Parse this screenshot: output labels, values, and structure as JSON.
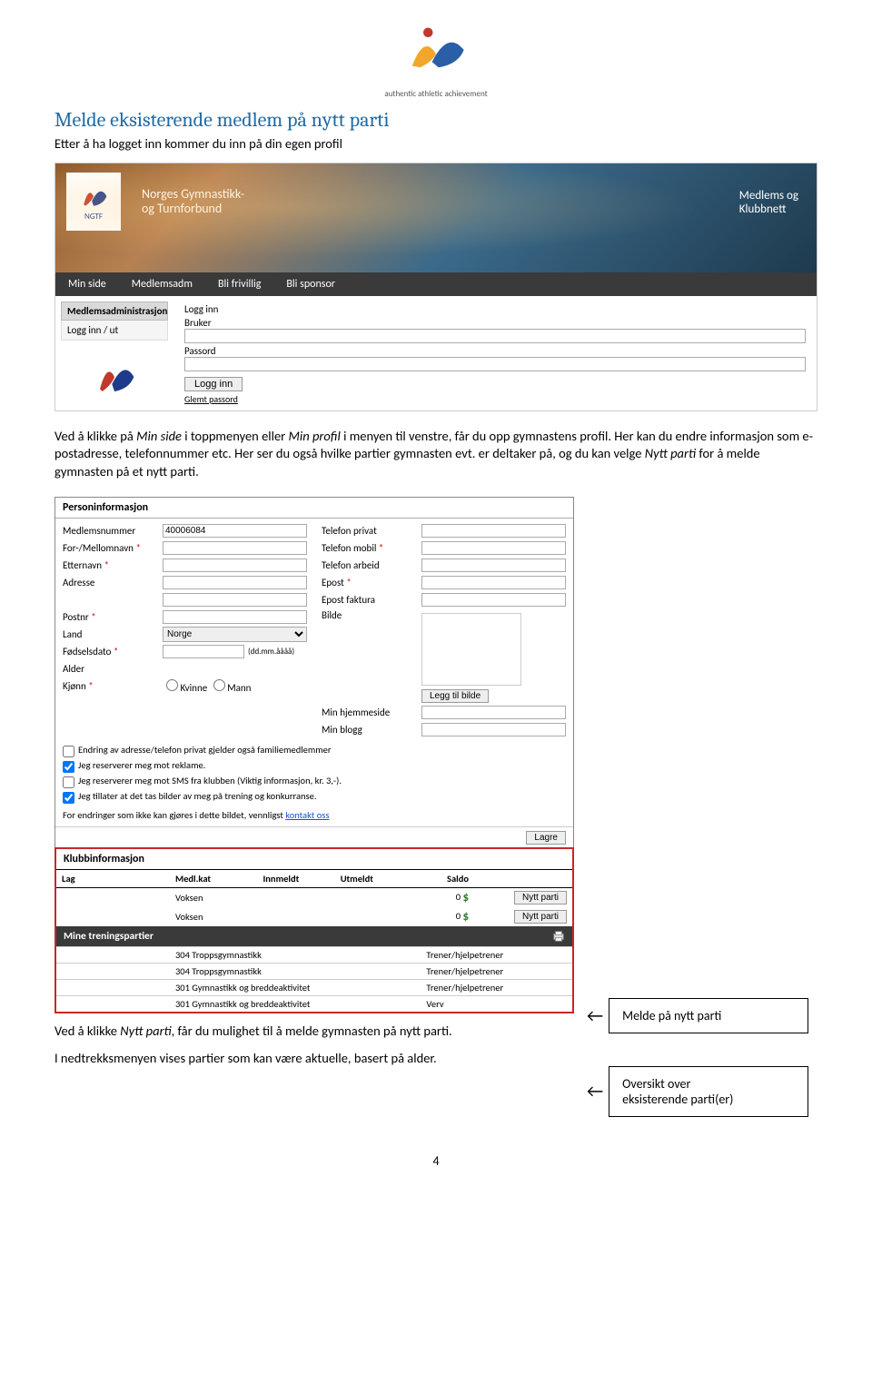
{
  "logo_caption": "authentic athletic achievement",
  "doc": {
    "heading": "Melde eksisterende medlem på nytt parti",
    "intro": "Etter å ha logget inn kommer du inn på din egen profil",
    "para1_a": "Ved å klikke på ",
    "para1_i1": "Min side",
    "para1_b": " i toppmenyen eller ",
    "para1_i2": "Min profil",
    "para1_c": " i menyen til venstre, får du opp gymnastens profil. Her kan du endre informasjon som e-postadresse, telefonnummer etc. Her ser du også hvilke partier gymnasten evt. er deltaker på, og du kan velge ",
    "para1_i3": "Nytt parti",
    "para1_d": " for å melde gymnasten på et nytt parti.",
    "para2_a": "Ved å klikke ",
    "para2_i1": "Nytt parti",
    "para2_b": ", får du mulighet til å melde gymnasten på nytt parti.",
    "para3": "I nedtrekksmenyen vises partier som kan være aktuelle, basert på alder.",
    "callout1": "Melde på nytt parti",
    "callout2a": "Oversikt over",
    "callout2b": "eksisterende parti(er)",
    "page": "4"
  },
  "login": {
    "ngtf": "NGTF",
    "title1": "Norges Gymnastikk-",
    "title2": "og Turnforbund",
    "right1": "Medlems og",
    "right2": "Klubbnett",
    "nav": [
      "Min side",
      "Medlemsadm",
      "Bli frivillig",
      "Bli sponsor"
    ],
    "side_hdr": "Medlemsadministrasjon",
    "side_link": "Logg inn / ut",
    "logg_inn_label": "Logg inn",
    "bruker": "Bruker",
    "passord": "Passord",
    "logg_inn_btn": "Logg inn",
    "glemt": "Glemt passord"
  },
  "person": {
    "header": "Personinformasjon",
    "left": {
      "medlemsnr_lbl": "Medlemsnummer",
      "medlemsnr_val": "40006084",
      "fornavn_lbl": "For-/Mellomnavn",
      "etternavn_lbl": "Etternavn",
      "adresse_lbl": "Adresse",
      "postnr_lbl": "Postnr",
      "land_lbl": "Land",
      "land_val": "Norge",
      "fdato_lbl": "Fødselsdato",
      "fdato_hint": "(dd.mm.åååå)",
      "alder_lbl": "Alder",
      "kjonn_lbl": "Kjønn",
      "kvinne": "Kvinne",
      "mann": "Mann",
      "chk1": "Endring av adresse/telefon privat gjelder også familiemedlemmer",
      "chk2": "Jeg reserverer meg mot reklame.",
      "chk3": "Jeg reserverer meg mot SMS fra klubben (Viktig informasjon, kr. 3,-).",
      "chk4": "Jeg tillater at det tas bilder av meg på trening og konkurranse.",
      "endr_note": "For endringer som ikke kan gjøres i dette bildet, vennligst ",
      "kontakt": "kontakt oss"
    },
    "right": {
      "tlf_priv": "Telefon privat",
      "tlf_mob": "Telefon mobil",
      "tlf_arb": "Telefon arbeid",
      "epost": "Epost",
      "epost_fakt": "Epost faktura",
      "bilde": "Bilde",
      "legg_bilde": "Legg til bilde",
      "hjemmeside": "Min hjemmeside",
      "blogg": "Min blogg"
    },
    "lagre": "Lagre"
  },
  "klubb": {
    "header": "Klubbinformasjon",
    "cols": [
      "Lag",
      "Medl.kat",
      "Innmeldt",
      "Utmeldt",
      "Saldo",
      ""
    ],
    "rows": [
      {
        "kat": "Voksen",
        "saldo": "0",
        "btn": "Nytt parti"
      },
      {
        "kat": "Voksen",
        "saldo": "0",
        "btn": "Nytt parti"
      }
    ]
  },
  "mine": {
    "header": "Mine treningspartier",
    "rows": [
      {
        "name": "304 Troppsgymnastikk",
        "role": "Trener/hjelpetrener"
      },
      {
        "name": "304 Troppsgymnastikk",
        "role": "Trener/hjelpetrener"
      },
      {
        "name": "301 Gymnastikk og breddeaktivitet",
        "role": "Trener/hjelpetrener"
      },
      {
        "name": "301 Gymnastikk og breddeaktivitet",
        "role": "Verv"
      }
    ]
  }
}
